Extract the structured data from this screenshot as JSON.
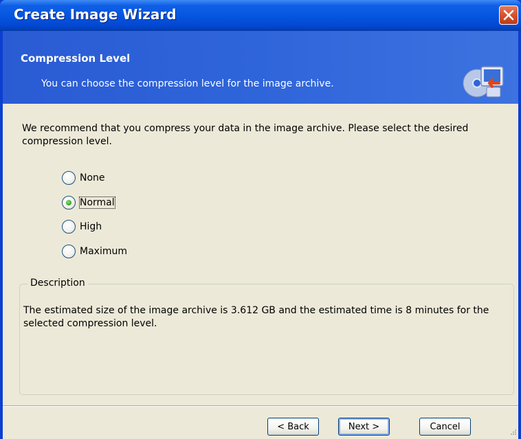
{
  "window": {
    "title": "Create Image Wizard",
    "close_icon": "close-x-icon"
  },
  "header": {
    "title": "Compression Level",
    "subtitle": "You can choose the compression level for the image archive.",
    "icon": "backup-disk-monitor-icon"
  },
  "intro": "We recommend that you compress your data in the image archive. Please select the desired compression level.",
  "options": {
    "selected": "Normal",
    "items": [
      {
        "label": "None",
        "checked": false
      },
      {
        "label": "Normal",
        "checked": true
      },
      {
        "label": "High",
        "checked": false
      },
      {
        "label": "Maximum",
        "checked": false
      }
    ]
  },
  "description": {
    "legend": "Description",
    "text": "The estimated size of the image archive is 3.612 GB and the estimated time is 8 minutes for the selected compression level."
  },
  "buttons": {
    "back": "< Back",
    "next": "Next >",
    "cancel": "Cancel"
  },
  "colors": {
    "title_bar": "#0656e0",
    "header_bg": "#2f65da",
    "dialog_bg": "#ece9d8",
    "close_button": "#d7512e",
    "radio_checked": "#3fae2a"
  }
}
